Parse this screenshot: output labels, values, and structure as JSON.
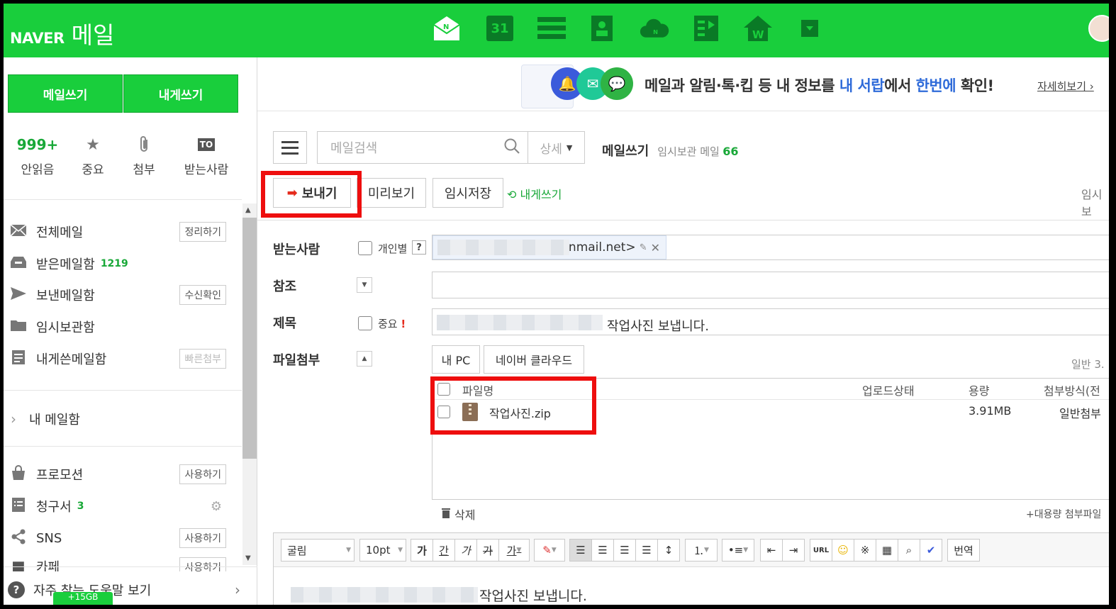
{
  "header": {
    "brand": "NAVER",
    "service": "메일",
    "apps": [
      "mail-icon",
      "calendar-icon",
      "list-icon",
      "contacts-icon",
      "cloud-icon",
      "memo-icon",
      "office-icon",
      "more-icon"
    ],
    "calendar_day": "31"
  },
  "sidebar": {
    "write_label": "메일쓰기",
    "self_write_label": "내게쓰기",
    "quick": [
      {
        "value": "999+",
        "label": "안읽음"
      },
      {
        "icon": "star-icon",
        "label": "중요"
      },
      {
        "icon": "paperclip-icon",
        "label": "첨부"
      },
      {
        "badge": "TO",
        "label": "받는사람"
      }
    ],
    "mailboxes": [
      {
        "label": "전체메일",
        "button": "정리하기"
      },
      {
        "label": "받은메일함",
        "count": "1219"
      },
      {
        "label": "보낸메일함",
        "button": "수신확인"
      },
      {
        "label": "임시보관함"
      },
      {
        "label": "내게쓴메일함",
        "button": "빠른첨부"
      }
    ],
    "my_mailbox_label": "내 메일함",
    "extras": [
      {
        "label": "프로모션",
        "button": "사용하기"
      },
      {
        "label": "청구서",
        "count": "3"
      },
      {
        "label": "SNS",
        "button": "사용하기"
      },
      {
        "label": "카페",
        "button": "사용하기"
      }
    ],
    "help_label": "자주 찾는 도움말 보기",
    "capacity_badge": "+15GB"
  },
  "banner": {
    "text_parts": [
      "메일과 알림·톡·킵 등 내 정보를 ",
      "내 서랍",
      "에서 ",
      "한번에",
      " 확인!"
    ],
    "more_label": "자세히보기 ›"
  },
  "search": {
    "placeholder": "메일검색",
    "detail_label": "상세"
  },
  "breadcrumb": {
    "title": "메일쓰기",
    "draft_label": "임시보관 메일",
    "draft_count": "66"
  },
  "toolbar": {
    "send_label": "보내기",
    "preview_label": "미리보기",
    "save_label": "임시저장",
    "self_write_label": "내게쓰기",
    "right_cut": "임시보"
  },
  "form": {
    "to_label": "받는사람",
    "individual_label": "개인별",
    "help_mark": "?",
    "to_chip_visible": "anmail.net>",
    "cc_label": "참조",
    "subject_label": "제목",
    "important_label": "중요",
    "important_mark": "!",
    "subject_visible": "작업사진 보냅니다.",
    "attach_label": "파일첨부",
    "my_pc_label": "내 PC",
    "cloud_label": "네이버 클라우드",
    "normal_cut": "일반 3."
  },
  "files": {
    "headers": [
      "파일명",
      "업로드상태",
      "용량",
      "첨부방식(전"
    ],
    "rows": [
      {
        "name": "작업사진.zip",
        "status": "",
        "size": "3.91MB",
        "method": "일반첨부"
      }
    ],
    "delete_label": "삭제",
    "large_file_label": "+대용량 첨부파일"
  },
  "editor": {
    "font": "굴림",
    "size": "10pt",
    "tools": [
      "가",
      "간",
      "가",
      "가",
      "가"
    ],
    "url_label": "URL",
    "translate_label": "번역",
    "body_visible": "작업사진 보냅니다."
  },
  "colors": {
    "brand_green": "#19ce3c",
    "highlight_red": "#ee0e0e",
    "count_green": "#19a838",
    "banner_blue": "#2f6bd9"
  }
}
